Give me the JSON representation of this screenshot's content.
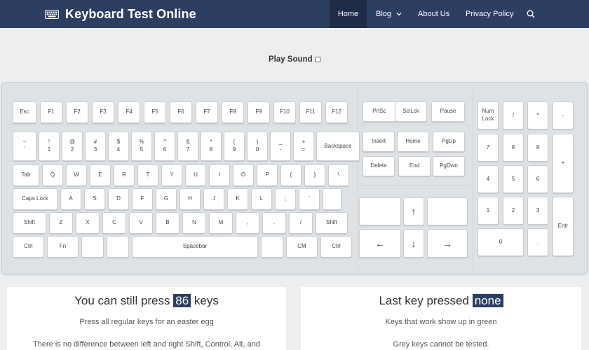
{
  "nav": {
    "brand": "Keyboard Test Online",
    "items": [
      {
        "label": "Home",
        "active": true
      },
      {
        "label": "Blog",
        "dropdown": true
      },
      {
        "label": "About Us"
      },
      {
        "label": "Privacy Policy"
      }
    ],
    "search_icon": "search-icon"
  },
  "play_sound": {
    "label": "Play Sound",
    "checked": false
  },
  "keyboard": {
    "main_rows": [
      [
        {
          "t": "Esc"
        },
        {
          "t": "F1"
        },
        {
          "t": "F2"
        },
        {
          "t": "F3"
        },
        {
          "t": "F4"
        },
        {
          "t": "F5"
        },
        {
          "t": "F6"
        },
        {
          "t": "F7"
        },
        {
          "t": "F8"
        },
        {
          "t": "F9"
        },
        {
          "t": "F10"
        },
        {
          "t": "F11"
        },
        {
          "t": "F12"
        }
      ],
      [
        {
          "t": "~",
          "b": "`"
        },
        {
          "t": "!",
          "b": "1"
        },
        {
          "t": "@",
          "b": "2"
        },
        {
          "t": "#",
          "b": "3"
        },
        {
          "t": "$",
          "b": "4"
        },
        {
          "t": "%",
          "b": "5"
        },
        {
          "t": "^",
          "b": "6"
        },
        {
          "t": "&",
          "b": "7"
        },
        {
          "t": "*",
          "b": "8"
        },
        {
          "t": "(",
          "b": "9"
        },
        {
          "t": ")",
          "b": "0"
        },
        {
          "t": "_",
          "b": "-"
        },
        {
          "t": "+",
          "b": "="
        },
        {
          "t": "Backspace"
        }
      ],
      [
        {
          "t": "Tab"
        },
        {
          "t": "Q"
        },
        {
          "t": "W"
        },
        {
          "t": "E"
        },
        {
          "t": "R"
        },
        {
          "t": "T"
        },
        {
          "t": "Y"
        },
        {
          "t": "U"
        },
        {
          "t": "I"
        },
        {
          "t": "O"
        },
        {
          "t": "P"
        },
        {
          "t": "{"
        },
        {
          "t": "}"
        },
        {
          "t": "\\"
        }
      ],
      [
        {
          "t": "Caps Lock"
        },
        {
          "t": "A"
        },
        {
          "t": "S"
        },
        {
          "t": "D"
        },
        {
          "t": "F"
        },
        {
          "t": "G"
        },
        {
          "t": "H"
        },
        {
          "t": "J"
        },
        {
          "t": "K"
        },
        {
          "t": "L"
        },
        {
          "t": ";"
        },
        {
          "t": "'"
        },
        {
          "t": ""
        }
      ],
      [
        {
          "t": "Shift"
        },
        {
          "t": "Z"
        },
        {
          "t": "X"
        },
        {
          "t": "C"
        },
        {
          "t": "V"
        },
        {
          "t": "B"
        },
        {
          "t": "N"
        },
        {
          "t": "M"
        },
        {
          "t": ","
        },
        {
          "t": "."
        },
        {
          "t": "/"
        },
        {
          "t": "Shift"
        }
      ],
      [
        {
          "t": "Ctrl"
        },
        {
          "t": "Fn"
        },
        {
          "t": ""
        },
        {
          "t": ""
        },
        {
          "t": "Spacebar"
        },
        {
          "t": ""
        },
        {
          "t": "CM"
        },
        {
          "t": "Ctrl"
        }
      ]
    ],
    "nav_keys": {
      "top": [
        {
          "t": "PrtSc"
        },
        {
          "t": "SclLck"
        },
        {
          "t": "Pause"
        }
      ],
      "row1": [
        {
          "t": "Insert"
        },
        {
          "t": "Home"
        },
        {
          "t": "PgUp"
        }
      ],
      "row2": [
        {
          "t": "Delete"
        },
        {
          "t": "End"
        },
        {
          "t": "PgDwn"
        }
      ],
      "arrows": {
        "up": "↑",
        "left": "←",
        "down": "↓",
        "right": "→"
      }
    },
    "numpad": [
      {
        "t": "Num",
        "b": "Lock"
      },
      {
        "t": "/"
      },
      {
        "t": "*"
      },
      {
        "t": "-"
      },
      {
        "t": "7"
      },
      {
        "t": "8"
      },
      {
        "t": "9"
      },
      {
        "t": "+"
      },
      {
        "t": "4"
      },
      {
        "t": "5"
      },
      {
        "t": "6"
      },
      {
        "t": "1"
      },
      {
        "t": "2"
      },
      {
        "t": "3"
      },
      {
        "t": "Entr"
      },
      {
        "t": "0"
      },
      {
        "t": "."
      }
    ]
  },
  "panel_left": {
    "title_prefix": "You can still press",
    "count": "86",
    "title_suffix": "keys",
    "line1": "Press all regular keys for an easter egg",
    "line2": "There is no difference between left and right Shift, Control, Alt, and"
  },
  "panel_right": {
    "title_prefix": "Last key pressed",
    "value": "none",
    "line1": "Keys that work show up in green",
    "line2": "Grey keys cannot be tested."
  }
}
